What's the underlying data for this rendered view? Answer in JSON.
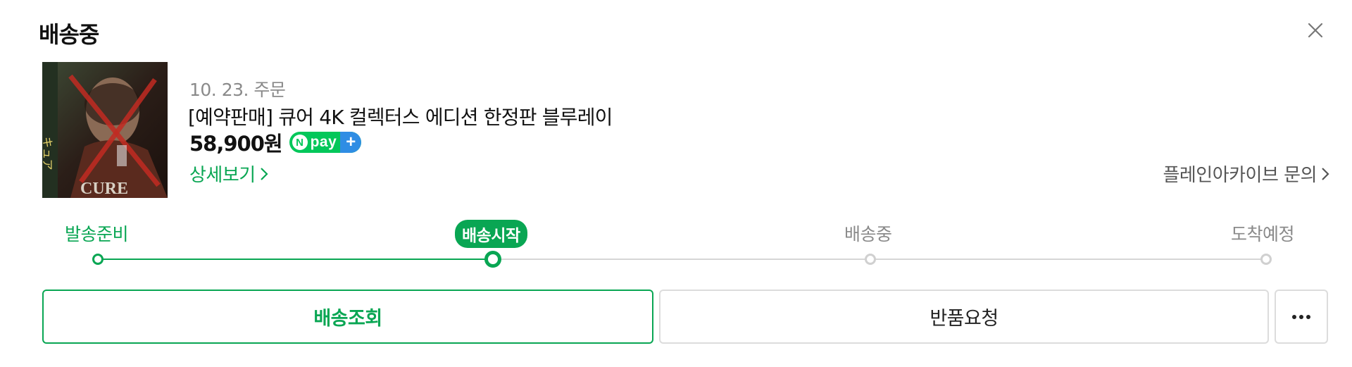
{
  "status": {
    "title": "배송중"
  },
  "close_label": "close",
  "order": {
    "date": "10. 23. 주문",
    "product_name": "[예약판매] 큐어 4K 컬렉터스 에디션 한정판 블루레이",
    "price": "58,900원",
    "npay": {
      "n": "N",
      "text": "pay",
      "plus": "+"
    },
    "detail_link": "상세보기",
    "seller_inquiry": "플레인아카이브 문의",
    "thumbnail": {
      "cover_text": "CURE"
    }
  },
  "progress": {
    "current_step": 1,
    "steps": [
      {
        "label": "발송준비",
        "state": "done"
      },
      {
        "label": "배송시작",
        "state": "current"
      },
      {
        "label": "배송중",
        "state": "pending"
      },
      {
        "label": "도착예정",
        "state": "pending"
      }
    ]
  },
  "actions": {
    "track_label": "배송조회",
    "return_label": "반품요청",
    "more_icon": "more-dots-icon"
  },
  "colors": {
    "accent": "#09a653",
    "pending": "#d6d6d6",
    "npay_green": "#03c75a",
    "npay_blue": "#2f8de4"
  }
}
